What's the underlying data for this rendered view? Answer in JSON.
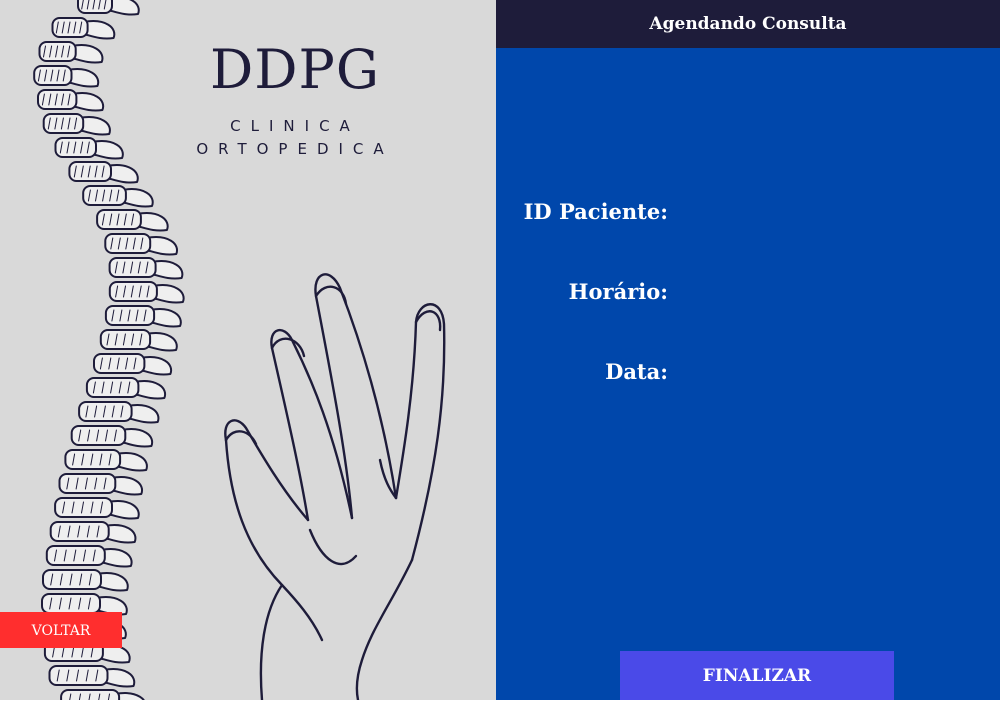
{
  "brand": {
    "name": "DDPG",
    "subtitle_line1": "CLINICA",
    "subtitle_line2": "ORTOPEDICA"
  },
  "illustration": {
    "spine": "spine-illustration",
    "hand": "hand-illustration"
  },
  "left": {
    "back_label": "VOLTAR"
  },
  "header": {
    "title": "Agendando Consulta"
  },
  "form": {
    "id_label": "ID Paciente:",
    "id_value": "",
    "time_label": "Horário:",
    "time_value": "",
    "date_label": "Data:",
    "date_value": ""
  },
  "footer": {
    "finish_label": "FINALIZAR"
  },
  "colors": {
    "left_background": "#d9d9d9",
    "right_background": "#0047ab",
    "header_background": "#1e1c3a",
    "back_button": "#ff2e2e",
    "finish_button": "#4a4ae8",
    "ink": "#1e1c3a"
  }
}
